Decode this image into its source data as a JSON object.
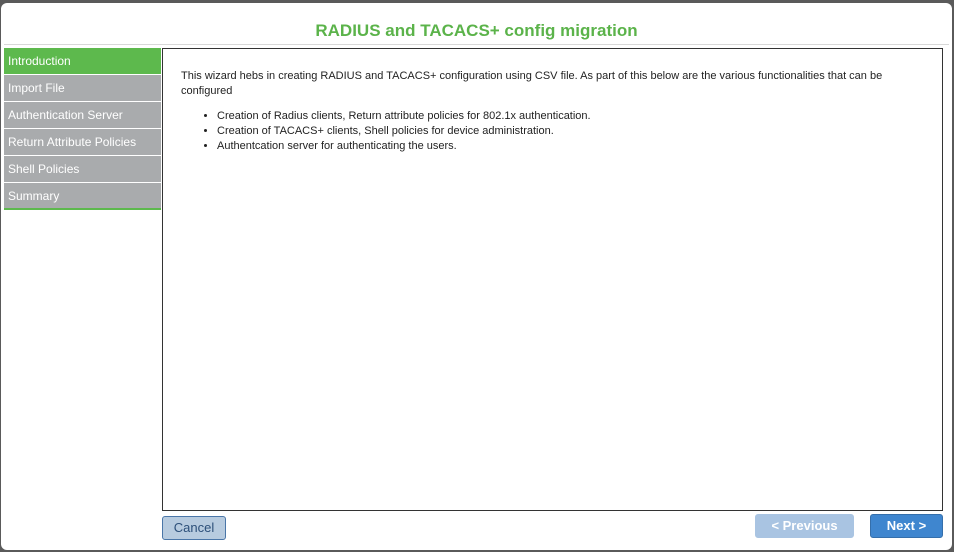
{
  "dialog": {
    "title": "RADIUS and TACACS+ config migration"
  },
  "sidebar": {
    "steps": [
      {
        "label": "Introduction"
      },
      {
        "label": "Import File"
      },
      {
        "label": "Authentication Server"
      },
      {
        "label": "Return Attribute Policies"
      },
      {
        "label": "Shell Policies"
      },
      {
        "label": "Summary"
      }
    ],
    "active_step": "Introduction"
  },
  "content": {
    "intro": "This wizard hebs in creating RADIUS and TACACS+ configuration using CSV file. As part of this  below are the various functionalities that can be configured",
    "features": [
      "Creation of Radius clients, Return attribute policies for 802.1x authentication.",
      "Creation of TACACS+ clients, Shell policies for device administration.",
      "Authentcation server for authenticating the users."
    ]
  },
  "buttons": {
    "cancel": "Cancel",
    "previous": "<  Previous",
    "next": "Next  >"
  },
  "colors": {
    "title": "#5bb34a",
    "active_step": "#5db94d",
    "inactive_step": "#a9abad",
    "primary_button": "#3f86cf",
    "disabled_button": "#a9c4e2"
  }
}
